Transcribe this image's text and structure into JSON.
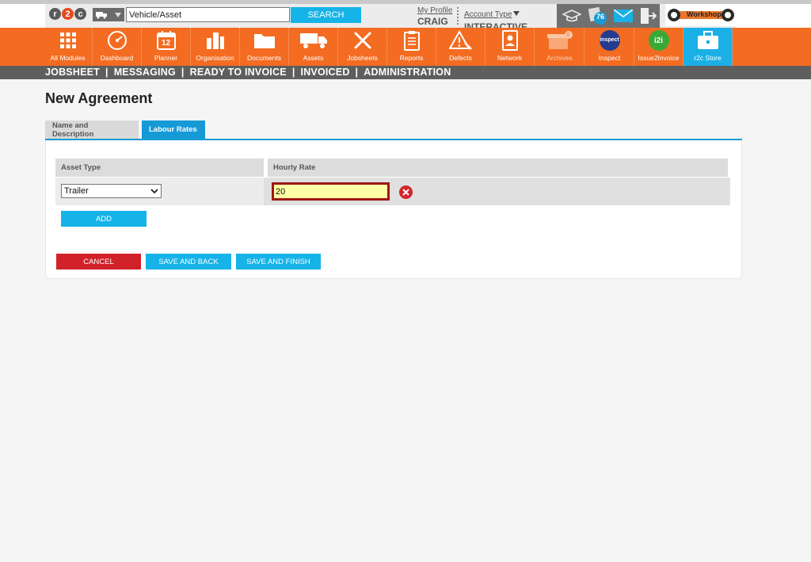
{
  "header": {
    "logo_text": "r2c",
    "search_placeholder": "Vehicle/Asset",
    "search_value": "Vehicle/Asset",
    "search_button": "SEARCH",
    "my_profile_label": "My Profile",
    "user_name": "CRAIG",
    "account_type_label": "Account Type",
    "account_type_value": "INTERACTIVE",
    "notification_count": "76",
    "workshop_label": "Workshop",
    "archives_badge": "0"
  },
  "modules": [
    {
      "label": "All Modules",
      "icon": "grid-icon"
    },
    {
      "label": "Dashboard",
      "icon": "gauge-icon"
    },
    {
      "label": "Planner",
      "icon": "calendar-icon"
    },
    {
      "label": "Organisation",
      "icon": "buildings-icon"
    },
    {
      "label": "Documents",
      "icon": "folder-icon"
    },
    {
      "label": "Assets",
      "icon": "truck-icon"
    },
    {
      "label": "Jobsheets",
      "icon": "tools-icon"
    },
    {
      "label": "Reports",
      "icon": "clipboard-icon"
    },
    {
      "label": "Defects",
      "icon": "warning-icon"
    },
    {
      "label": "Network",
      "icon": "contacts-icon"
    },
    {
      "label": "Archives",
      "icon": "archive-icon"
    },
    {
      "label": "Inspect",
      "icon": "inspect-icon"
    },
    {
      "label": "Issue2Invoice",
      "icon": "i2i-icon"
    },
    {
      "label": "r2c Store",
      "icon": "briefcase-icon"
    }
  ],
  "calendar_day": "12",
  "inspect_logo": "inspect",
  "i2i_logo": "i2i",
  "subnav": [
    "JOBSHEET",
    "MESSAGING",
    "READY TO INVOICE",
    "INVOICED",
    "ADMINISTRATION"
  ],
  "subnav_separator": "|",
  "page": {
    "title": "New Agreement",
    "tabs": [
      "Name and Description",
      "Labour Rates"
    ],
    "active_tab": "Labour Rates"
  },
  "labour_rates": {
    "columns": [
      "Asset Type",
      "Hourly Rate"
    ],
    "rows": [
      {
        "asset_type": "Trailer",
        "hourly_rate": "20"
      }
    ],
    "add_button": "ADD"
  },
  "actions": {
    "cancel": "CANCEL",
    "save_and_back": "SAVE AND BACK",
    "save_and_finish": "SAVE AND FINISH"
  },
  "colors": {
    "brand_orange": "#f36c21",
    "accent_blue": "#16b3e8",
    "danger_red": "#d12229",
    "nav_grey": "#5e5e5e"
  }
}
